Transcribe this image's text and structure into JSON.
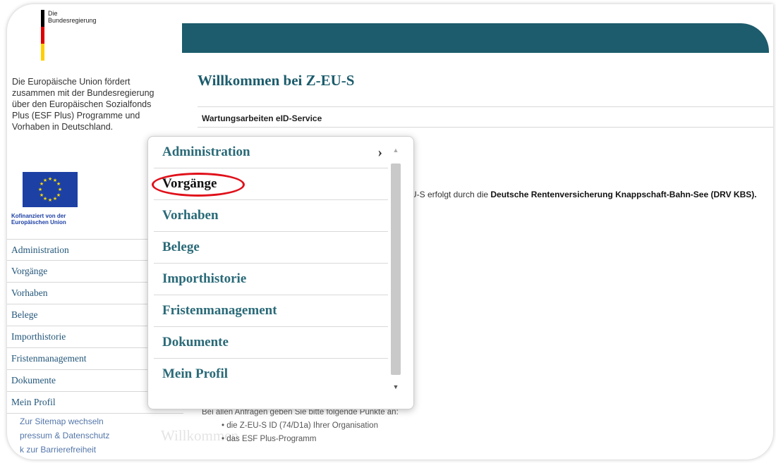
{
  "brand": {
    "logo_top": "Die",
    "logo_name": "Bundesregierung"
  },
  "intro_text": "Die Europäische Union fördert zusammen mit der Bundesregierung über den Europäischen Sozialfonds Plus (ESF Plus) Programme und Vorhaben in Deutschland.",
  "eu": {
    "caption_line1": "Kofinanziert von der",
    "caption_line2": "Europäischen Union"
  },
  "side_nav": [
    {
      "label": "Administration"
    },
    {
      "label": "Vorgänge"
    },
    {
      "label": "Vorhaben"
    },
    {
      "label": "Belege"
    },
    {
      "label": "Importhistorie"
    },
    {
      "label": "Fristenmanagement"
    },
    {
      "label": "Dokumente"
    },
    {
      "label": "Mein Profil"
    }
  ],
  "footer_links": [
    "Zur Sitemap wechseln",
    "pressum & Datenschutz",
    "k zur Barrierefreiheit"
  ],
  "main": {
    "welcome": "Willkommen bei Z-EU-S",
    "maintenance": "Wartungsarbeiten eID-Service",
    "info_prefix": "U-S erfolgt durch die ",
    "info_bold": "Deutsche Rentenversicherung Knappschaft-Bahn-See (DRV KBS).",
    "bottom_intro": "Bei allen Anfragen geben Sie bitte folgende Punkte an:",
    "bottom_items": [
      "die Z-EU-S ID (74/D1a) Ihrer Organisation",
      "das ESF Plus-Programm"
    ],
    "ghost_text": "Willkommen"
  },
  "popup_menu": {
    "items": [
      {
        "label": "Administration",
        "has_submenu": true,
        "active": false
      },
      {
        "label": "Vorgänge",
        "has_submenu": false,
        "active": true
      },
      {
        "label": "Vorhaben",
        "has_submenu": false,
        "active": false
      },
      {
        "label": "Belege",
        "has_submenu": false,
        "active": false
      },
      {
        "label": "Importhistorie",
        "has_submenu": false,
        "active": false
      },
      {
        "label": "Fristenmanagement",
        "has_submenu": false,
        "active": false
      },
      {
        "label": "Dokumente",
        "has_submenu": false,
        "active": false
      },
      {
        "label": "Mein Profil",
        "has_submenu": false,
        "active": false
      }
    ],
    "chevron": "›",
    "highlight_color": "#e0101a"
  },
  "colors": {
    "banner": "#1c5c6c",
    "nav_text": "#24577a",
    "menu_text": "#2a6a78"
  }
}
